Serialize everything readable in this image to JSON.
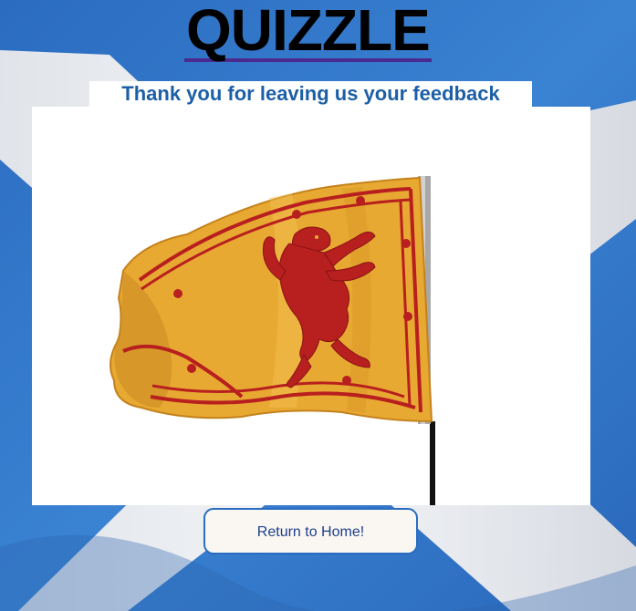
{
  "header": {
    "logo_text": "QUIZZLE",
    "subtitle": "Thank you for leaving us your feedback"
  },
  "main": {
    "image_description": "lion-rampant-flag",
    "return_button_label": "Return to Home!"
  },
  "colors": {
    "background_blue": "#2f74c6",
    "saltire_white": "#f2f2f4",
    "subtitle_blue": "#1c5fa6",
    "logo_underline": "#4a2a8f",
    "flag_gold": "#e8a932",
    "flag_red": "#b81f1f",
    "button_border": "#2a6cc0"
  }
}
